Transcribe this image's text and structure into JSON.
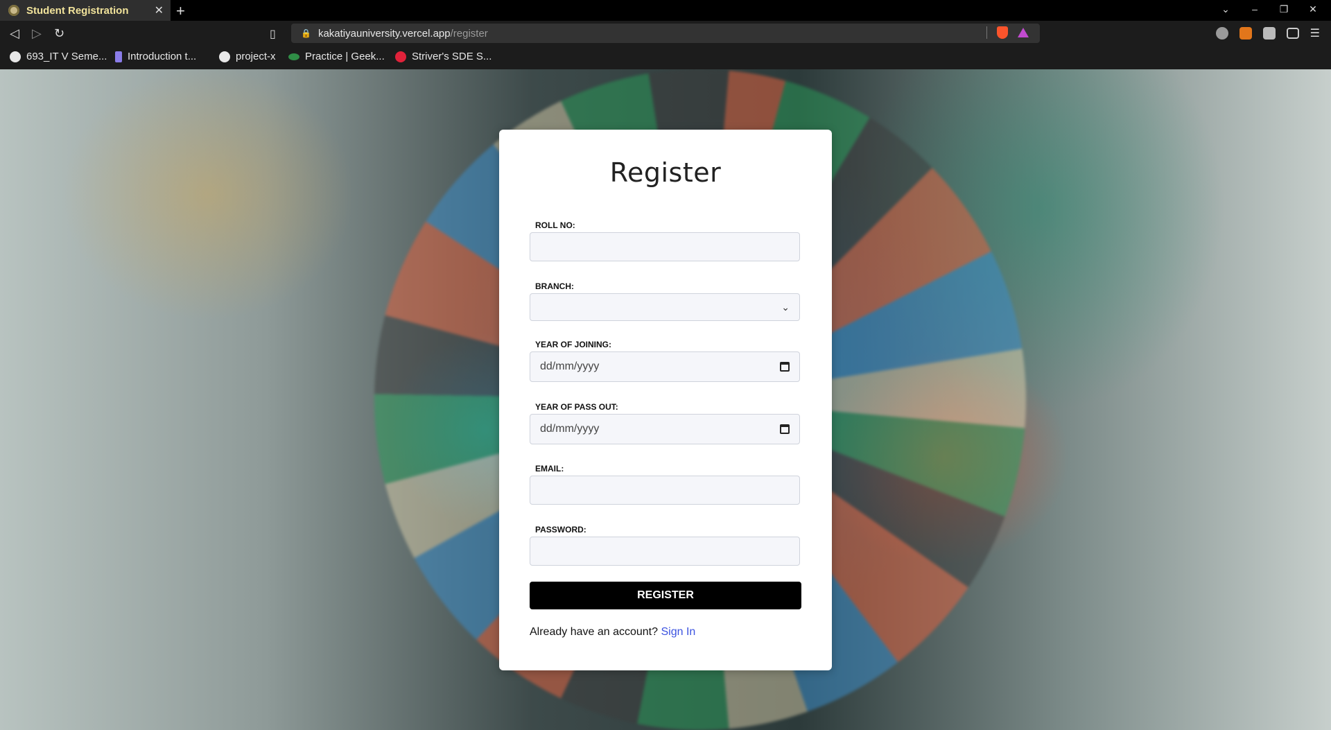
{
  "browser": {
    "tab_title": "Student Registration",
    "new_tab": "+",
    "url_host": "kakatiyauniversity.vercel.app",
    "url_path": "/register",
    "bookmarks": [
      {
        "label": "693_IT V Seme...",
        "color": "#e8e8e8"
      },
      {
        "label": "Introduction t...",
        "color": "#8a7ce8"
      },
      {
        "label": "project-x",
        "color": "#e8e8e8"
      },
      {
        "label": "Practice | Geek...",
        "color": "#2f8d46"
      },
      {
        "label": "Striver's SDE S...",
        "color": "#e0223a"
      }
    ]
  },
  "form": {
    "title": "Register",
    "roll_label": "ROLL NO:",
    "branch_label": "BRANCH:",
    "join_label": "YEAR OF JOINING:",
    "join_placeholder": "dd/mm/yyyy",
    "passout_label": "YEAR OF PASS OUT:",
    "passout_placeholder": "dd/mm/yyyy",
    "email_label": "EMAIL:",
    "password_label": "PASSWORD:",
    "submit_label": "REGISTER",
    "signin_prompt": "Already have an account?",
    "signin_link": "Sign In"
  }
}
